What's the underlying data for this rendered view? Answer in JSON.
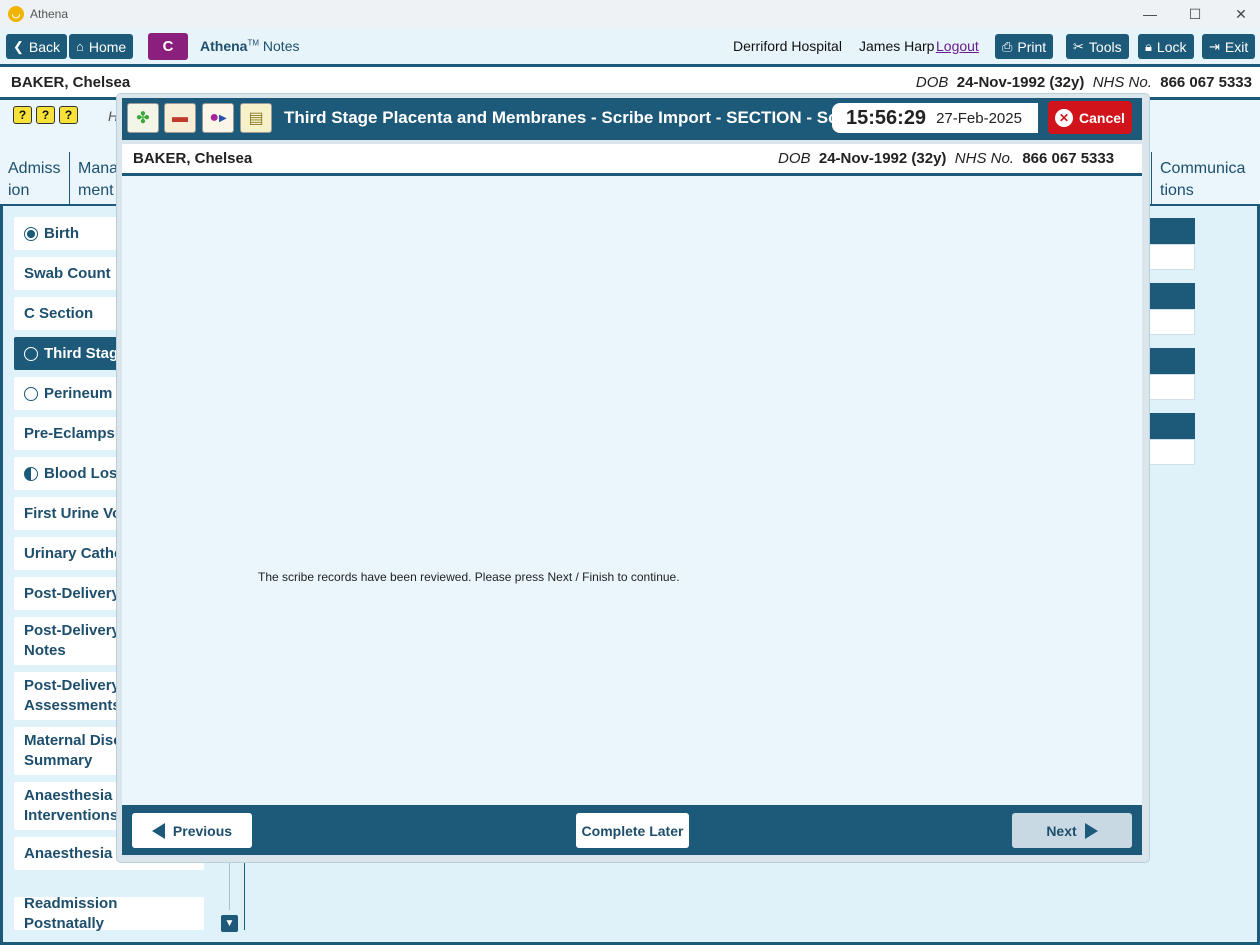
{
  "window": {
    "title": "Athena",
    "minimize": "—",
    "maximize": "☐",
    "close": "✕"
  },
  "toolbar": {
    "back": "Back",
    "home": "Home",
    "c_label": "C",
    "brand_bold": "Athena",
    "brand_tm": "TM",
    "brand_rest": "Notes",
    "hospital": "Derriford Hospital",
    "user": "James Harp",
    "logout": "Logout",
    "print": "Print",
    "tools": "Tools",
    "lock": "Lock",
    "exit": "Exit"
  },
  "patient": {
    "name": "BAKER, Chelsea",
    "dob_label": "DOB",
    "dob": "24-Nov-1992 (32y)",
    "nhs_label": "NHS No.",
    "nhs": "866 067 5333"
  },
  "help_icons": [
    "?",
    "?",
    "?"
  ],
  "hidden_letter": "H",
  "tabs": {
    "admission": "Admiss ion",
    "management": "Mana ment",
    "communications": "Communica tions"
  },
  "sidebar": [
    {
      "label": "Birth",
      "radio": "filled"
    },
    {
      "label": "Swab Count"
    },
    {
      "label": "C Section"
    },
    {
      "label": "Third Stage",
      "radio": "empty",
      "selected": true
    },
    {
      "label": "Perineum",
      "radio": "empty"
    },
    {
      "label": "Pre-Eclampsia"
    },
    {
      "label": "Blood Loss",
      "radio": "half"
    },
    {
      "label": "First Urine Voi"
    },
    {
      "label": "Urinary Cathe"
    },
    {
      "label": "Post-Delivery"
    },
    {
      "label": "Post-Delivery Notes"
    },
    {
      "label": "Post-Delivery Assessments"
    },
    {
      "label": "Maternal Disc Summary"
    },
    {
      "label": "Anaesthesia Interventions"
    },
    {
      "label": "Anaesthesia F"
    },
    {
      "label": "Readmission Postnatally"
    }
  ],
  "modal": {
    "title": "Third Stage Placenta and Membranes - Scribe Import - SECTION - Scribe",
    "time": "15:56:29",
    "date": "27-Feb-2025",
    "cancel": "Cancel",
    "message": "The scribe records have been reviewed. Please press Next / Finish to continue.",
    "previous": "Previous",
    "complete_later": "Complete Later",
    "next": "Next"
  },
  "colors": {
    "primary": "#1d5a7a",
    "cancel": "#d1141c",
    "purple": "#8a1f7d",
    "background": "#eaf6fc"
  }
}
